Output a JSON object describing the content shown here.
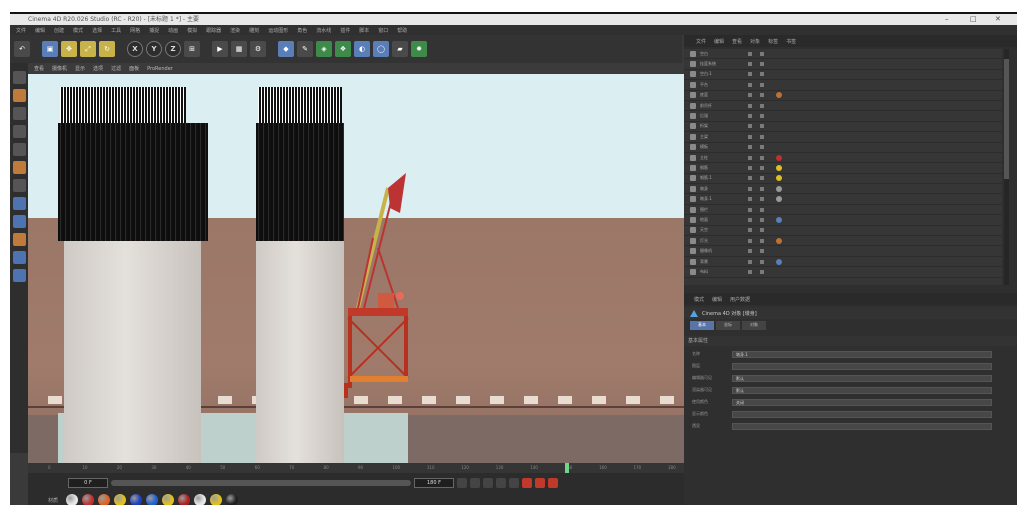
{
  "titlebar": {
    "title": "Cinema 4D R20.026 Studio (RC - R20) - [未标题 1 *] - 主要",
    "minimize": "–",
    "maximize": "□",
    "close": "✕"
  },
  "menubar": [
    "文件",
    "编辑",
    "创建",
    "模式",
    "选择",
    "工具",
    "网格",
    "捕捉",
    "动画",
    "模拟",
    "跟踪器",
    "渲染",
    "雕刻",
    "运动图形",
    "角色",
    "流水线",
    "插件",
    "脚本",
    "窗口",
    "帮助"
  ],
  "toolbar": {
    "axis_x": "X",
    "axis_y": "Y",
    "axis_z": "Z"
  },
  "viewport": {
    "menu": [
      "查看",
      "摄像机",
      "显示",
      "选项",
      "过滤",
      "面板",
      "ProRender"
    ]
  },
  "timeline": {
    "ruler_ticks": [
      "0",
      "10",
      "20",
      "30",
      "40",
      "50",
      "60",
      "70",
      "80",
      "90",
      "100",
      "110",
      "120",
      "130",
      "140",
      "150",
      "160",
      "170",
      "180"
    ],
    "current_frame": "0 F",
    "end_frame": "180 F",
    "materials_label": "材质",
    "material_colors": [
      "#e8e8e8",
      "#c03030",
      "#e06020",
      "#e0c020",
      "#1a40c0",
      "#2060d0",
      "#e0c020",
      "#b02020",
      "#e8e8e8",
      "#e0c020",
      "#202020"
    ]
  },
  "object_manager": {
    "tabs": [
      "文件",
      "编辑",
      "查看",
      "对象",
      "标签",
      "书签"
    ],
    "rows": [
      {
        "name": "空白",
        "tag": ""
      },
      {
        "name": "挂篮系统",
        "tag": ""
      },
      {
        "name": "空白.1",
        "tag": ""
      },
      {
        "name": "平台",
        "tag": ""
      },
      {
        "name": "底篮",
        "tag": "#c07030"
      },
      {
        "name": "前吊杆",
        "tag": ""
      },
      {
        "name": "后锚",
        "tag": ""
      },
      {
        "name": "桁架",
        "tag": ""
      },
      {
        "name": "主梁",
        "tag": ""
      },
      {
        "name": "模板",
        "tag": ""
      },
      {
        "name": "立柱",
        "tag": "#c03030"
      },
      {
        "name": "钢筋",
        "tag": "#e0c020"
      },
      {
        "name": "钢筋.1",
        "tag": "#e0c020"
      },
      {
        "name": "墩身",
        "tag": "#9a9a9a"
      },
      {
        "name": "墩身.1",
        "tag": "#9a9a9a"
      },
      {
        "name": "围栏",
        "tag": ""
      },
      {
        "name": "地面",
        "tag": "#5a7fb8"
      },
      {
        "name": "天空",
        "tag": ""
      },
      {
        "name": "灯光",
        "tag": "#c07030"
      },
      {
        "name": "摄像机",
        "tag": ""
      },
      {
        "name": "背景",
        "tag": "#5a7fb8"
      },
      {
        "name": "布料",
        "tag": ""
      }
    ]
  },
  "attributes": {
    "tabs": [
      "模式",
      "编辑",
      "用户数据"
    ],
    "object_title": "Cinema 4D 对象 [墩身]",
    "subtabs": [
      "基本",
      "坐标",
      "对象"
    ],
    "section": "基本属性",
    "rows": [
      {
        "label": "名称",
        "value": "墩身.1"
      },
      {
        "label": "图层",
        "value": ""
      },
      {
        "label": "编辑器可见",
        "value": "默认"
      },
      {
        "label": "渲染器可见",
        "value": "默认"
      },
      {
        "label": "使用颜色",
        "value": "关闭"
      },
      {
        "label": "显示颜色",
        "value": ""
      },
      {
        "label": "透显",
        "value": ""
      }
    ]
  }
}
